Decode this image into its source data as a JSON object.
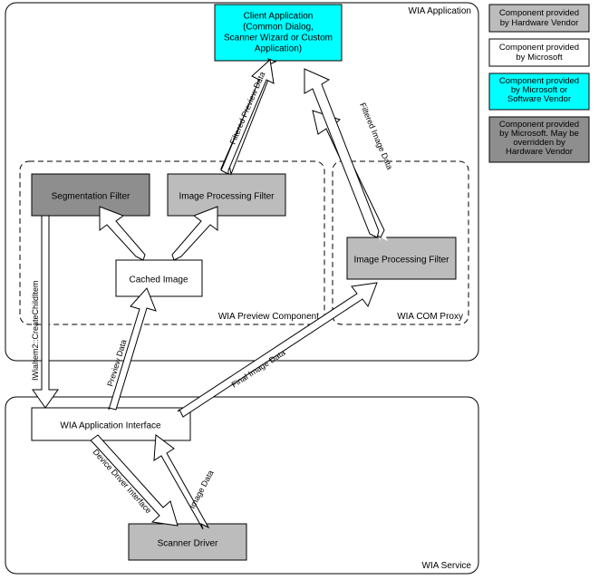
{
  "containers": {
    "wia_application": "WIA Application",
    "wia_preview": "WIA Preview Component",
    "wia_com_proxy": "WIA COM Proxy",
    "wia_service": "WIA Service"
  },
  "boxes": {
    "client_app": {
      "l1": "Client Application",
      "l2": "(Common Dialog,",
      "l3": "Scanner Wizard or Custom",
      "l4": "Application)"
    },
    "seg_filter": "Segmentation Filter",
    "ipf_preview": "Image Processing Filter",
    "cached_image": "Cached Image",
    "ipf_proxy": "Image Processing Filter",
    "wia_app_interface": "WIA Application Interface",
    "scanner_driver": "Scanner Driver"
  },
  "arrows": {
    "filtered_preview": "Filtered Preview Data",
    "filtered_image": "Filtered Image Data",
    "create_child": "IWiaItem2::CreateChildItem",
    "preview_data": "Preview Data",
    "final_image": "Final Image Data",
    "ddi": "Device Driver Interface",
    "image_data": "Image Data"
  },
  "legend": [
    {
      "color": "#bcbcbc",
      "l1": "Component provided",
      "l2": "by Hardware Vendor",
      "l3": ""
    },
    {
      "color": "#ffffff",
      "l1": "Component provided",
      "l2": "by Microsoft",
      "l3": ""
    },
    {
      "color": "#00ffff",
      "l1": "Component provided",
      "l2": "by Microsoft or",
      "l3": "Software Vendor"
    },
    {
      "color": "#8e8e8e",
      "l1": "Component provided",
      "l2": "by Microsoft. May be",
      "l3": "overridden by",
      "l4": "Hardware Vendor"
    }
  ],
  "colors": {
    "hw_vendor": "#bcbcbc",
    "microsoft": "#ffffff",
    "ms_or_sw": "#00ffff",
    "ms_override": "#8e8e8e",
    "stroke": "#000000"
  }
}
